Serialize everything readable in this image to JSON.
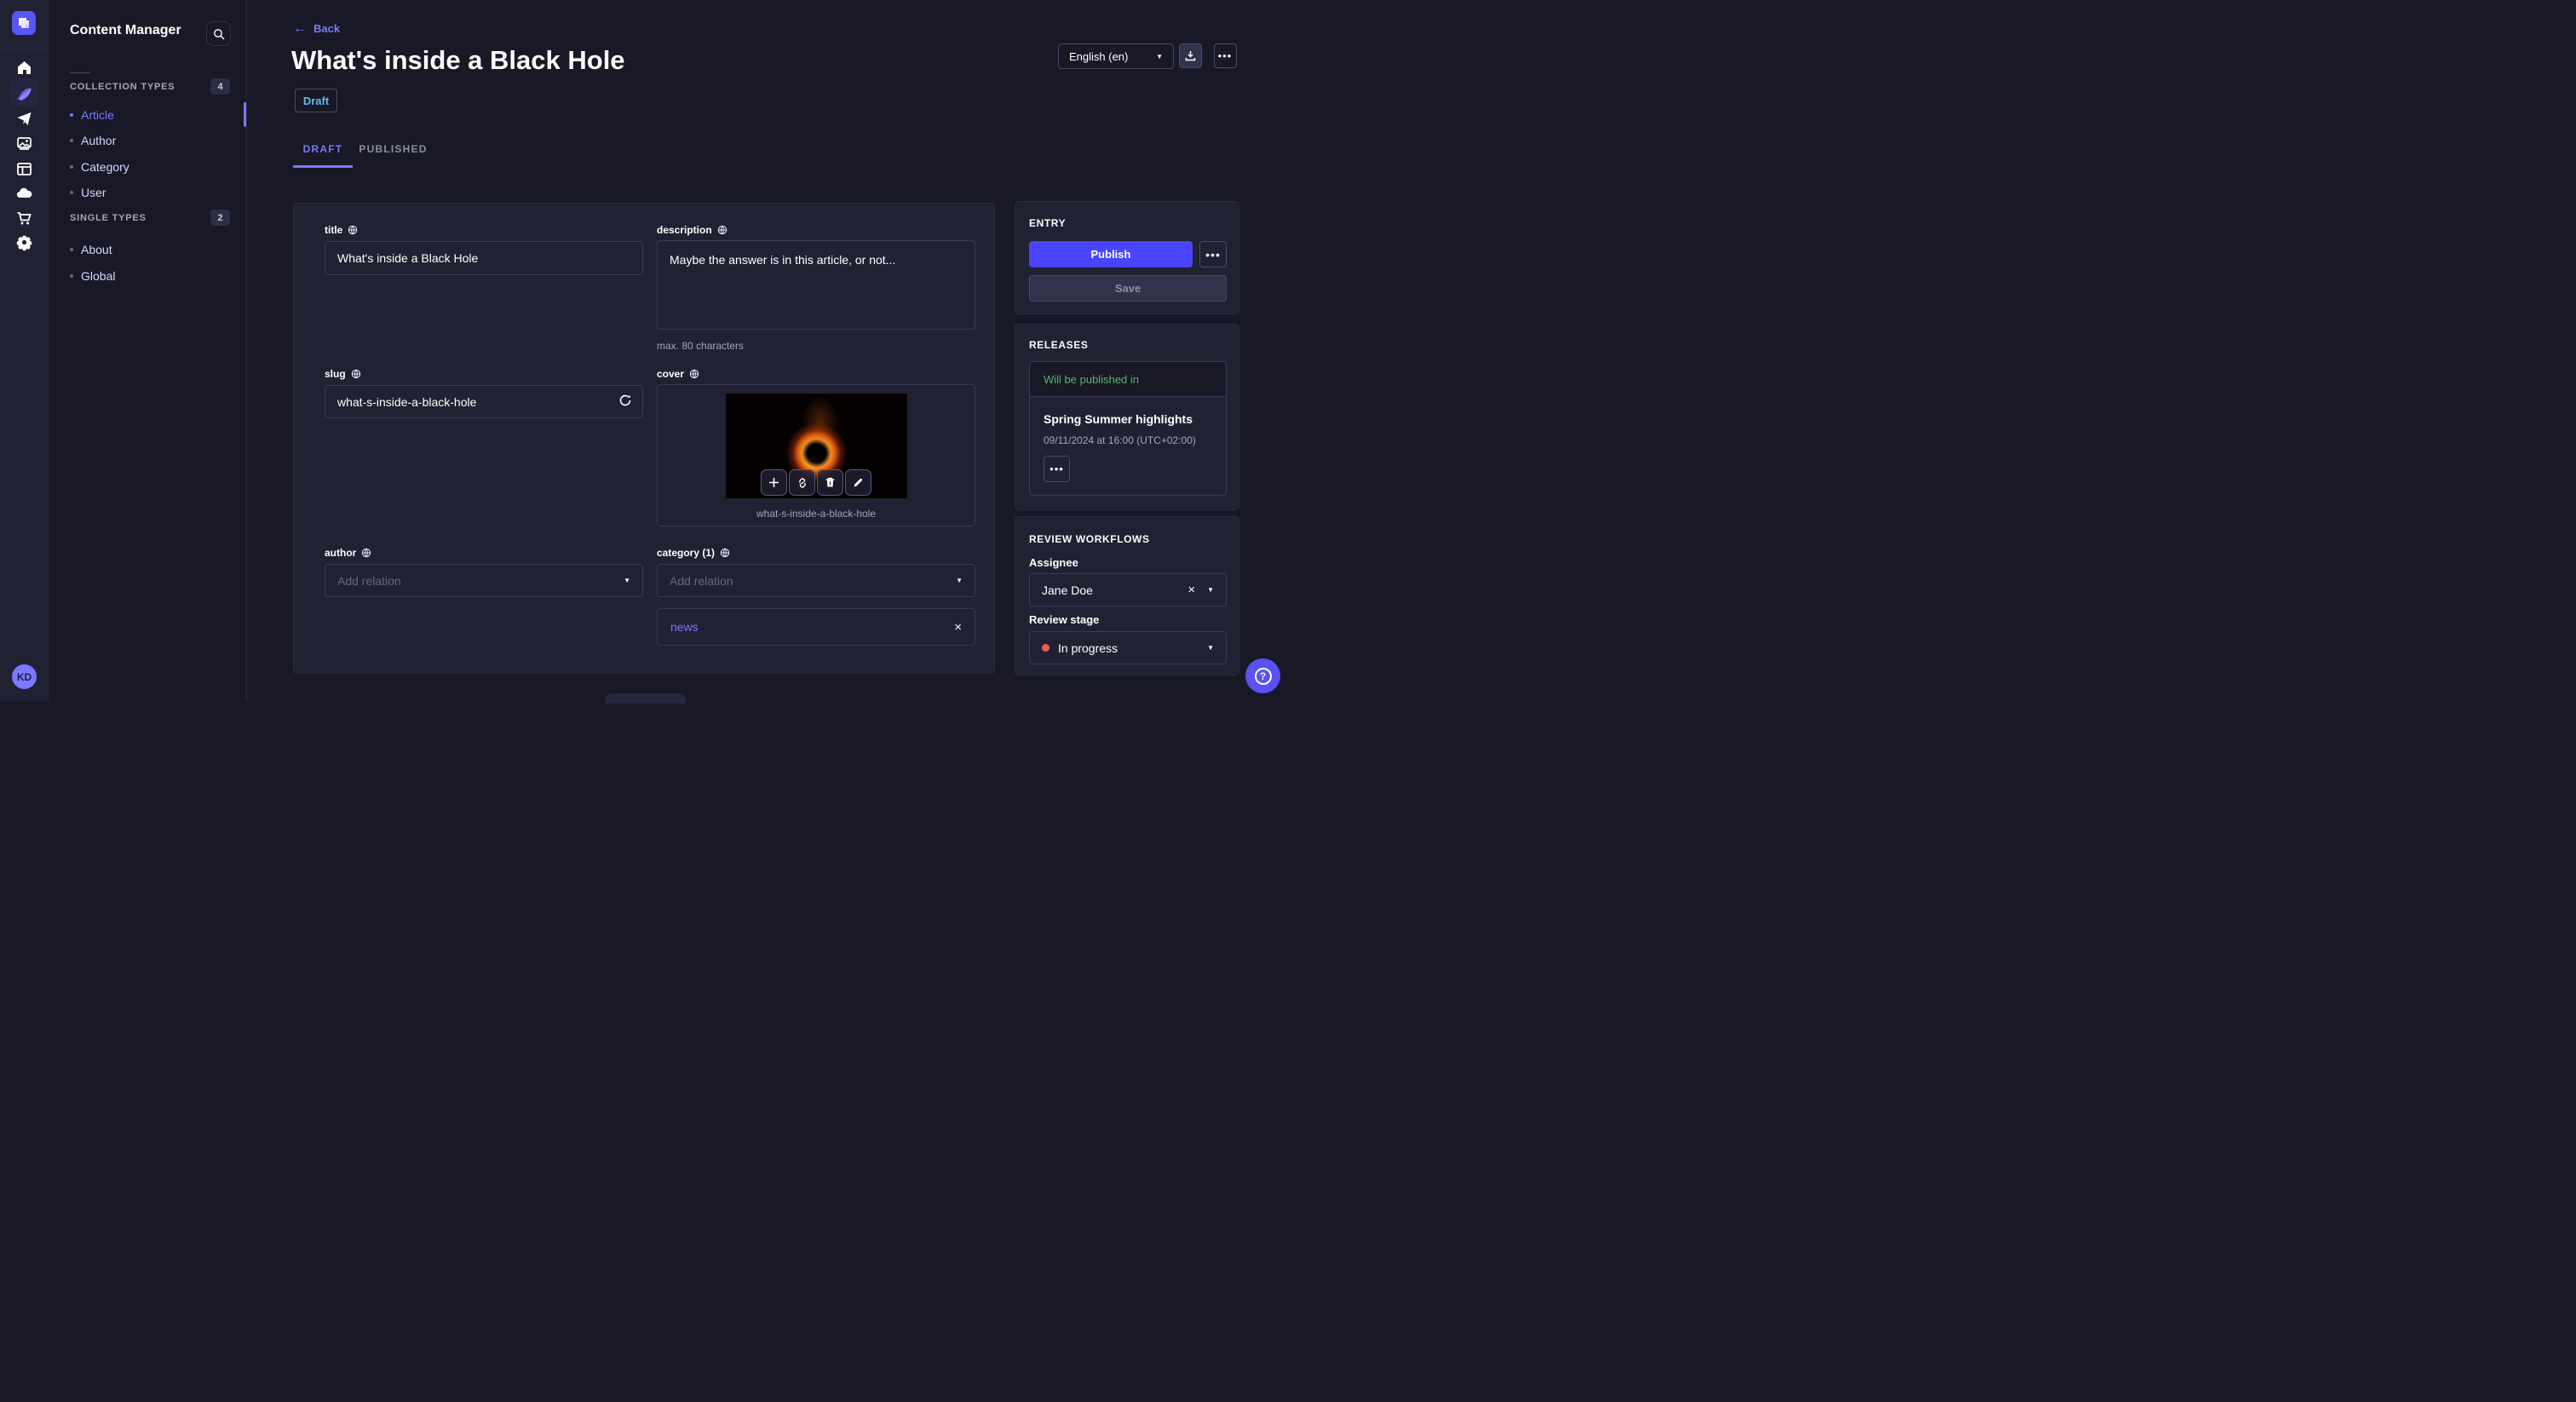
{
  "colors": {
    "accent": "#4945ff",
    "link_purple": "#7b79ff",
    "draft_blue": "#66b7f1",
    "success_green": "#5cb176",
    "danger_red": "#ee5e52"
  },
  "rail": {
    "avatar_initials": "KD"
  },
  "subnav": {
    "title": "Content Manager",
    "collection": {
      "label": "COLLECTION TYPES",
      "count": "4",
      "items": [
        {
          "label": "Article"
        },
        {
          "label": "Author"
        },
        {
          "label": "Category"
        },
        {
          "label": "User"
        }
      ]
    },
    "single": {
      "label": "SINGLE TYPES",
      "count": "2",
      "items": [
        {
          "label": "About"
        },
        {
          "label": "Global"
        }
      ]
    }
  },
  "header": {
    "back_label": "Back",
    "title": "What's inside a Black Hole",
    "status": "Draft",
    "locale": "English (en)",
    "more_label": "...",
    "tabs": {
      "draft": "DRAFT",
      "published": "PUBLISHED"
    }
  },
  "form": {
    "title": {
      "label": "title",
      "value": "What's inside a Black Hole"
    },
    "description": {
      "label": "description",
      "value": "Maybe the answer is in this article, or not...",
      "helper": "max. 80 characters"
    },
    "slug": {
      "label": "slug",
      "value": "what-s-inside-a-black-hole"
    },
    "cover": {
      "label": "cover",
      "caption": "what-s-inside-a-black-hole"
    },
    "author": {
      "label": "author",
      "placeholder": "Add relation"
    },
    "category": {
      "label": "category (1)",
      "placeholder": "Add relation",
      "relation": "news"
    }
  },
  "entry_panel": {
    "heading": "ENTRY",
    "publish_label": "Publish",
    "save_label": "Save",
    "more_label": "..."
  },
  "releases_panel": {
    "heading": "RELEASES",
    "status": "Will be published in",
    "release_title": "Spring Summer highlights",
    "release_date": "09/11/2024 at 16:00 (UTC+02:00)",
    "more_label": "..."
  },
  "review_panel": {
    "heading": "REVIEW WORKFLOWS",
    "assignee_label": "Assignee",
    "assignee_value": "Jane Doe",
    "stage_label": "Review stage",
    "stage_value": "In progress"
  }
}
